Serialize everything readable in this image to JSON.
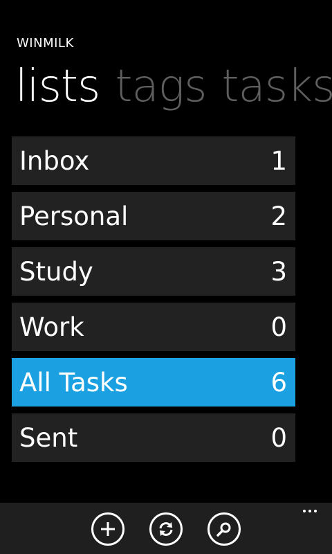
{
  "app": {
    "title": "WINMILK"
  },
  "pivot": {
    "items": [
      "lists",
      "tags",
      "tasks"
    ],
    "active": "lists"
  },
  "lists": [
    {
      "name": "Inbox",
      "count": "1"
    },
    {
      "name": "Personal",
      "count": "2"
    },
    {
      "name": "Study",
      "count": "3"
    },
    {
      "name": "Work",
      "count": "0"
    },
    {
      "name": "All Tasks",
      "count": "6",
      "selected": true
    },
    {
      "name": "Sent",
      "count": "0"
    }
  ],
  "appbar": {
    "buttons": [
      "add-icon",
      "sync-icon",
      "search-icon"
    ],
    "more": "more-icon"
  },
  "colors": {
    "background": "#000000",
    "tile": "#222222",
    "accent": "#1ba1e2",
    "inactive_text": "#5e5e5e",
    "appbar": "#1f1f1f"
  }
}
